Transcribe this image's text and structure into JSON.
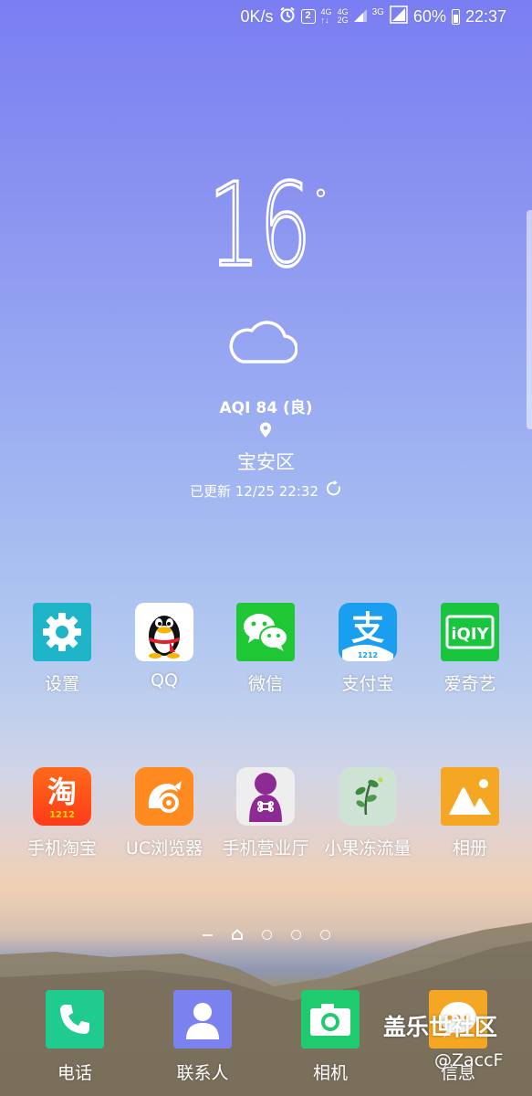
{
  "status_bar": {
    "speed": "0K/s",
    "alarm_icon": "alarm-clock-icon",
    "notification_count": "2",
    "sim1": {
      "top": "4G",
      "bottom": "↑↓"
    },
    "sim2": {
      "top": "4G",
      "bottom": "2G"
    },
    "network": "3G",
    "battery_percent": "60%",
    "time": "22:37"
  },
  "weather": {
    "temperature": "16",
    "degree_symbol": "°",
    "condition_icon": "cloud-icon",
    "aqi": "AQI 84 (良)",
    "location_icon": "location-pin-icon",
    "district": "宝安区",
    "updated": "已更新 12/25 22:32",
    "refresh_icon": "refresh-icon"
  },
  "apps_row1": [
    {
      "label": "设置",
      "icon": "gear-icon",
      "color": "#1fb5c9"
    },
    {
      "label": "QQ",
      "icon": "penguin-icon",
      "color": "#ffffff"
    },
    {
      "label": "微信",
      "icon": "chat-bubbles-icon",
      "color": "#1ec733"
    },
    {
      "label": "支付宝",
      "icon": "alipay-icon",
      "color": "#1a9ff0"
    },
    {
      "label": "爱奇艺",
      "icon": "iqiyi-icon",
      "color": "#19c53c"
    }
  ],
  "apps_row2": [
    {
      "label": "手机淘宝",
      "icon": "taobao-icon",
      "color": "#ff4a1a"
    },
    {
      "label": "UC浏览器",
      "icon": "squirrel-icon",
      "color": "#ff8a1f"
    },
    {
      "label": "手机营业厅",
      "icon": "unicom-icon",
      "color": "#9b2a9e"
    },
    {
      "label": "小果冻流量",
      "icon": "plant-icon",
      "color": "#cfe3d4"
    },
    {
      "label": "相册",
      "icon": "mountain-photo-icon",
      "color": "#f5a623"
    }
  ],
  "icon_text": {
    "alipay_badge": "1212",
    "taobao_char": "淘",
    "taobao_badge": "1212",
    "iqiyi": "iQIY"
  },
  "dock": [
    {
      "label": "电话",
      "icon": "phone-icon",
      "color": "#1fcb8f"
    },
    {
      "label": "联系人",
      "icon": "contact-person-icon",
      "color": "#7b82f0"
    },
    {
      "label": "相机",
      "icon": "camera-icon",
      "color": "#1fcb6f"
    },
    {
      "label": "信息",
      "icon": "message-bubble-icon",
      "color": "#f5a623"
    }
  ],
  "watermark": {
    "site": "盖乐世社区",
    "user": "@ZaccF"
  }
}
